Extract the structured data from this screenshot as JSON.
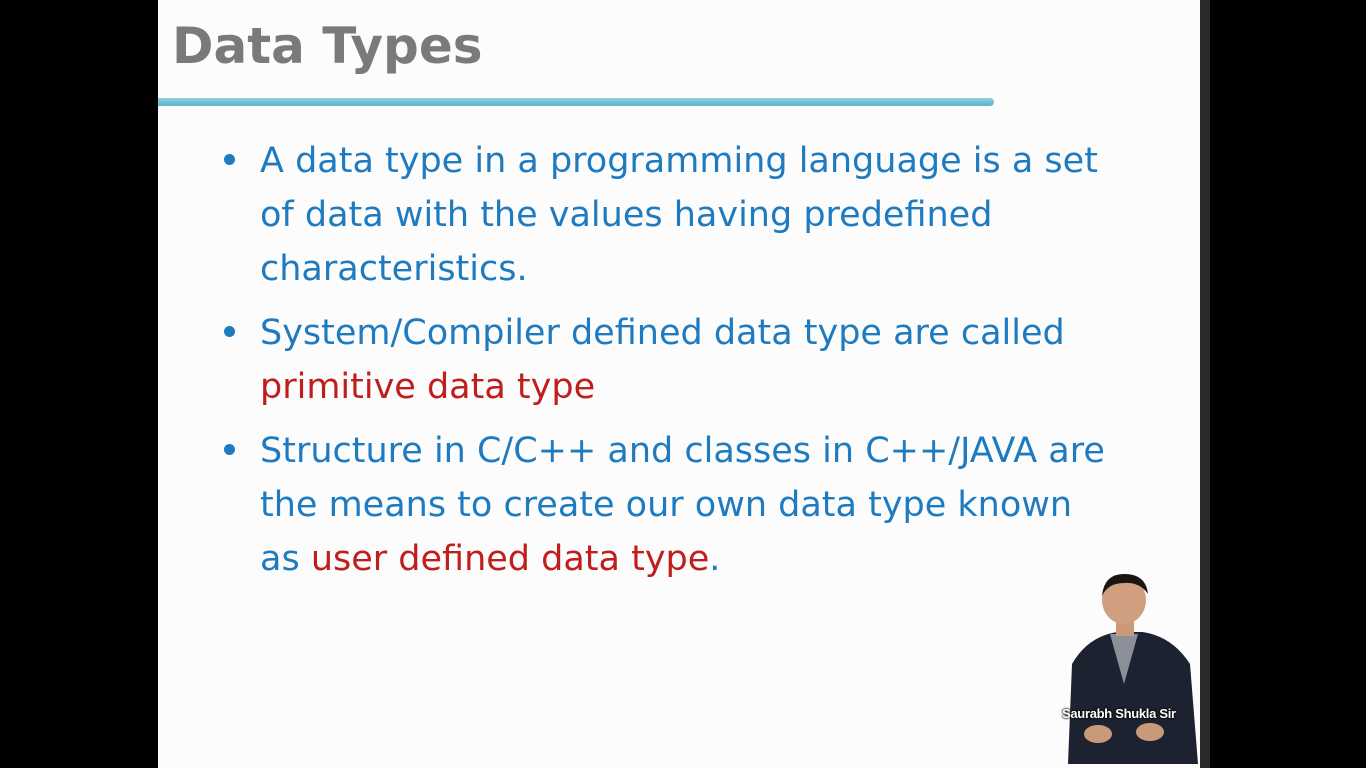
{
  "slide": {
    "title": "Data Types",
    "bullets": [
      {
        "text_before": "A data type in a programming language is a set of data with the values having predefined characteristics.",
        "highlight": "",
        "text_after": ""
      },
      {
        "text_before": "System/Compiler defined data type are called ",
        "highlight": "primitive data type",
        "text_after": ""
      },
      {
        "text_before": "Structure in C/C++ and classes in C++/JAVA are the means to create our own data type known as ",
        "highlight": "user defined data type",
        "text_after": "."
      }
    ],
    "presenter_caption": "Saurabh Shukla Sir"
  },
  "colors": {
    "title": "#7a7a7a",
    "body_text": "#1f7bc0",
    "highlight": "#c01d1d",
    "rule": "#6fbcd3",
    "letterbox": "#000000"
  }
}
